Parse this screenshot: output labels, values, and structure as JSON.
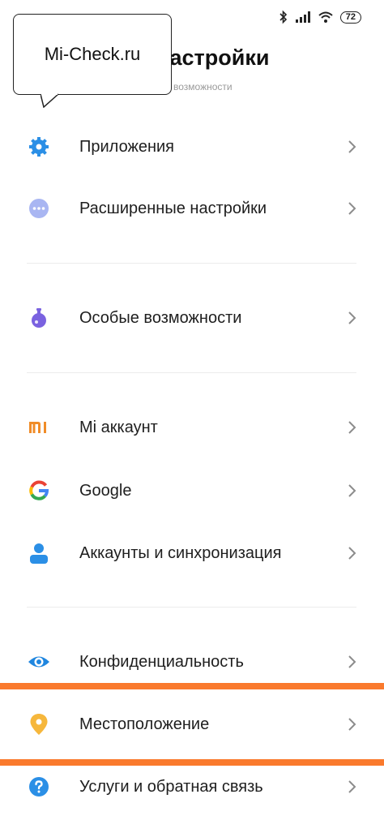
{
  "status_bar": {
    "battery": "72"
  },
  "header": {
    "title": "Настройки",
    "subtitle": "Все возможности"
  },
  "bubble": {
    "text": "Mi-Check.ru"
  },
  "colors": {
    "highlight": "#fa7a2d",
    "accent_blue": "#2b8fe6",
    "chevron": "#8c8c8c",
    "divider": "#ececec"
  },
  "menu": [
    {
      "label": "Приложения",
      "icon": "gear-icon"
    },
    {
      "label": "Расширенные настройки",
      "icon": "more-dots-icon"
    },
    {
      "label": "Особые возможности",
      "icon": "flask-icon"
    },
    {
      "label": "Mi аккаунт",
      "icon": "mi-logo-icon"
    },
    {
      "label": "Google",
      "icon": "google-g-icon"
    },
    {
      "label": "Аккаунты и синхронизация",
      "icon": "person-icon"
    },
    {
      "label": "Конфиденциальность",
      "icon": "eye-icon"
    },
    {
      "label": "Местоположение",
      "icon": "location-pin-icon"
    },
    {
      "label": "Услуги и обратная связь",
      "icon": "help-icon"
    }
  ]
}
